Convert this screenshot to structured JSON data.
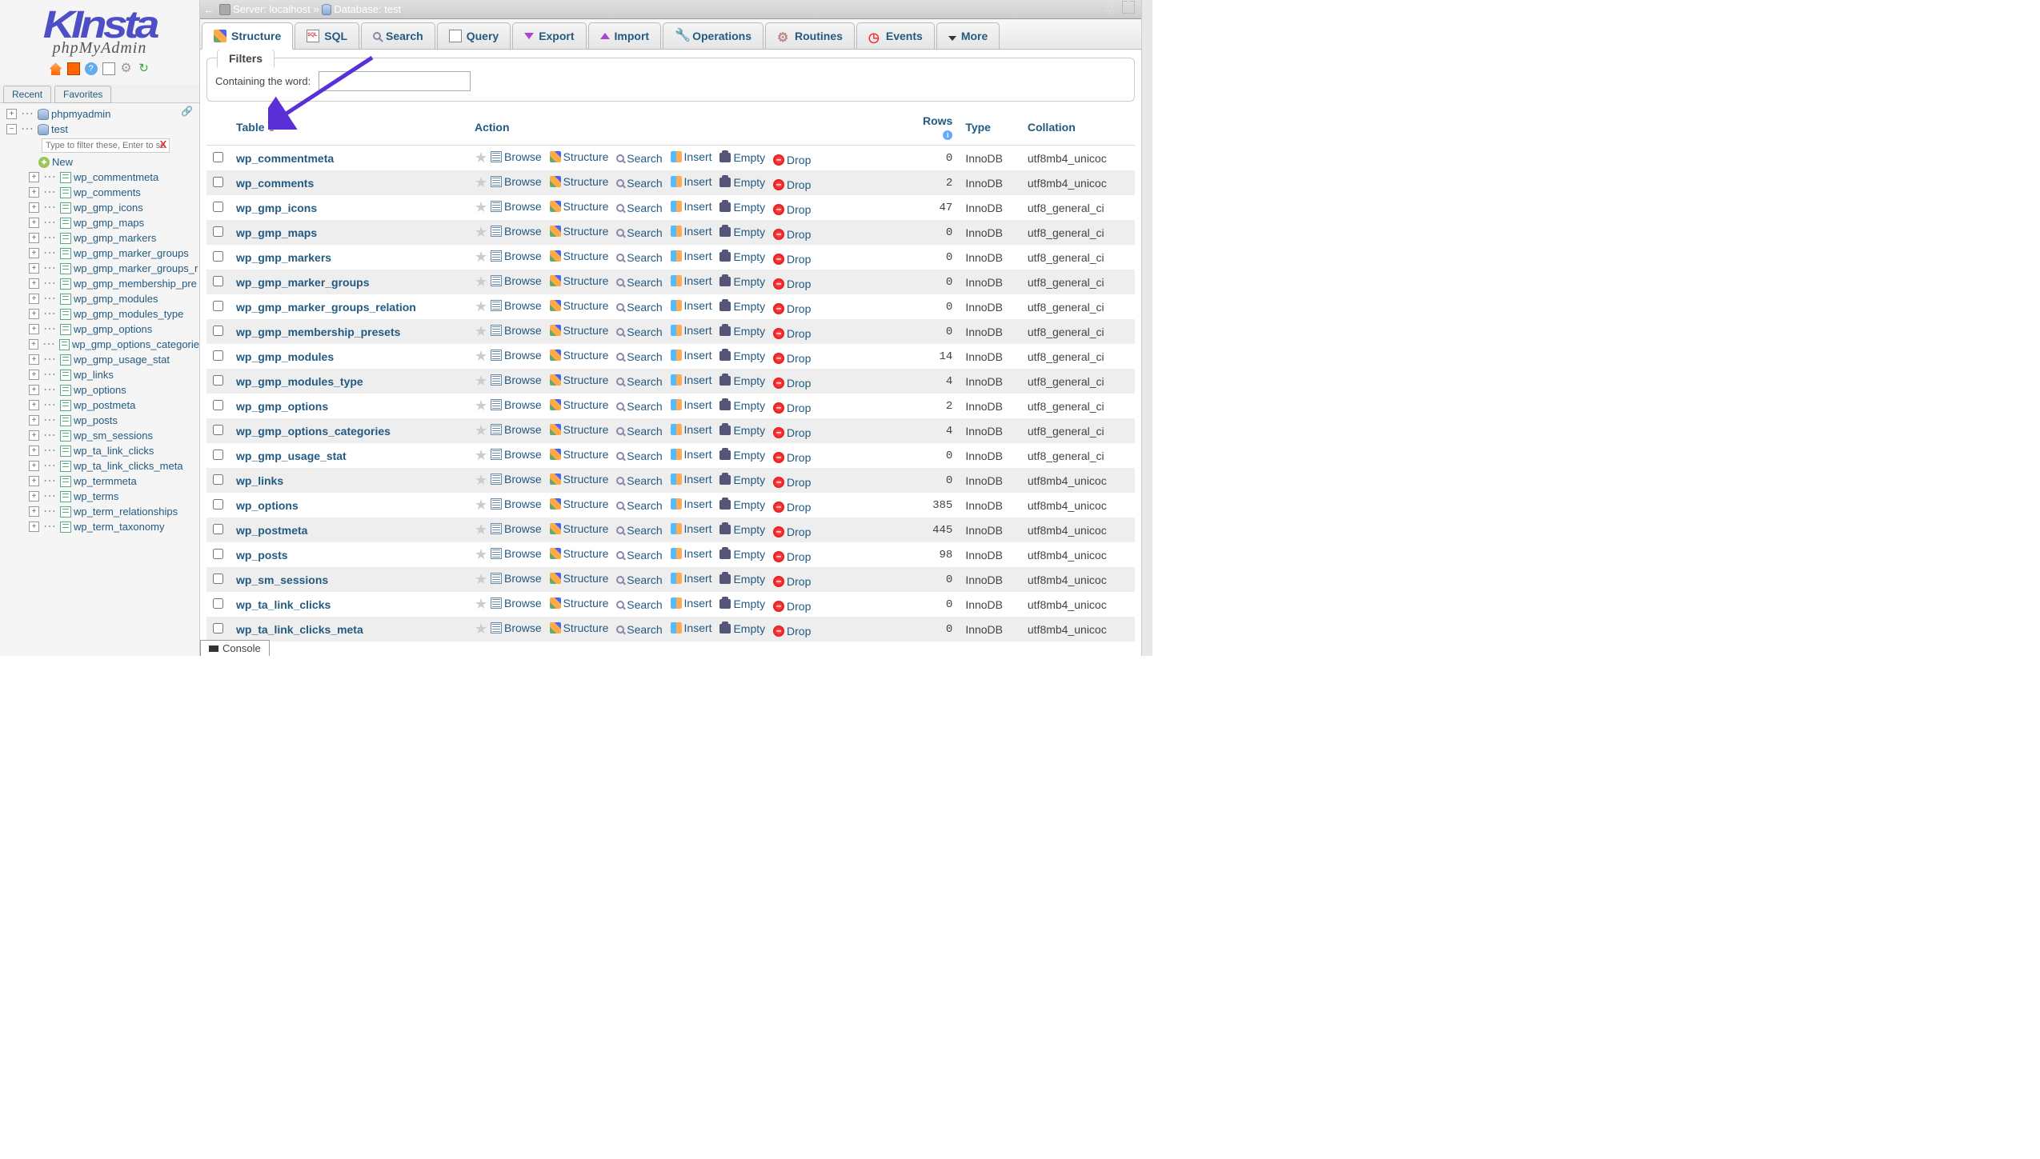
{
  "logo": {
    "main": "KInsta",
    "sub": "phpMyAdmin"
  },
  "left_tabs": {
    "recent": "Recent",
    "favorites": "Favorites"
  },
  "tree": {
    "root": "phpmyadmin",
    "db": "test",
    "filter_placeholder": "Type to filter these, Enter to search",
    "new_label": "New",
    "tables": [
      "wp_commentmeta",
      "wp_comments",
      "wp_gmp_icons",
      "wp_gmp_maps",
      "wp_gmp_markers",
      "wp_gmp_marker_groups",
      "wp_gmp_marker_groups_r",
      "wp_gmp_membership_pre",
      "wp_gmp_modules",
      "wp_gmp_modules_type",
      "wp_gmp_options",
      "wp_gmp_options_categorie",
      "wp_gmp_usage_stat",
      "wp_links",
      "wp_options",
      "wp_postmeta",
      "wp_posts",
      "wp_sm_sessions",
      "wp_ta_link_clicks",
      "wp_ta_link_clicks_meta",
      "wp_termmeta",
      "wp_terms",
      "wp_term_relationships",
      "wp_term_taxonomy"
    ]
  },
  "breadcrumb": {
    "server_label": "Server:",
    "server": "localhost",
    "sep": "»",
    "db_label": "Database:",
    "db": "test"
  },
  "tabs": [
    "Structure",
    "SQL",
    "Search",
    "Query",
    "Export",
    "Import",
    "Operations",
    "Routines",
    "Events",
    "More"
  ],
  "filter": {
    "title": "Filters",
    "label": "Containing the word:"
  },
  "columns": {
    "table": "Table",
    "action": "Action",
    "rows": "Rows",
    "type": "Type",
    "collation": "Collation"
  },
  "actions": {
    "browse": "Browse",
    "structure": "Structure",
    "search": "Search",
    "insert": "Insert",
    "empty": "Empty",
    "drop": "Drop"
  },
  "rows": [
    {
      "name": "wp_commentmeta",
      "rows": "0",
      "type": "InnoDB",
      "collation": "utf8mb4_unicoc"
    },
    {
      "name": "wp_comments",
      "rows": "2",
      "type": "InnoDB",
      "collation": "utf8mb4_unicoc"
    },
    {
      "name": "wp_gmp_icons",
      "rows": "47",
      "type": "InnoDB",
      "collation": "utf8_general_ci"
    },
    {
      "name": "wp_gmp_maps",
      "rows": "0",
      "type": "InnoDB",
      "collation": "utf8_general_ci"
    },
    {
      "name": "wp_gmp_markers",
      "rows": "0",
      "type": "InnoDB",
      "collation": "utf8_general_ci"
    },
    {
      "name": "wp_gmp_marker_groups",
      "rows": "0",
      "type": "InnoDB",
      "collation": "utf8_general_ci"
    },
    {
      "name": "wp_gmp_marker_groups_relation",
      "rows": "0",
      "type": "InnoDB",
      "collation": "utf8_general_ci"
    },
    {
      "name": "wp_gmp_membership_presets",
      "rows": "0",
      "type": "InnoDB",
      "collation": "utf8_general_ci"
    },
    {
      "name": "wp_gmp_modules",
      "rows": "14",
      "type": "InnoDB",
      "collation": "utf8_general_ci"
    },
    {
      "name": "wp_gmp_modules_type",
      "rows": "4",
      "type": "InnoDB",
      "collation": "utf8_general_ci"
    },
    {
      "name": "wp_gmp_options",
      "rows": "2",
      "type": "InnoDB",
      "collation": "utf8_general_ci"
    },
    {
      "name": "wp_gmp_options_categories",
      "rows": "4",
      "type": "InnoDB",
      "collation": "utf8_general_ci"
    },
    {
      "name": "wp_gmp_usage_stat",
      "rows": "0",
      "type": "InnoDB",
      "collation": "utf8_general_ci"
    },
    {
      "name": "wp_links",
      "rows": "0",
      "type": "InnoDB",
      "collation": "utf8mb4_unicoc"
    },
    {
      "name": "wp_options",
      "rows": "385",
      "type": "InnoDB",
      "collation": "utf8mb4_unicoc"
    },
    {
      "name": "wp_postmeta",
      "rows": "445",
      "type": "InnoDB",
      "collation": "utf8mb4_unicoc"
    },
    {
      "name": "wp_posts",
      "rows": "98",
      "type": "InnoDB",
      "collation": "utf8mb4_unicoc"
    },
    {
      "name": "wp_sm_sessions",
      "rows": "0",
      "type": "InnoDB",
      "collation": "utf8mb4_unicoc"
    },
    {
      "name": "wp_ta_link_clicks",
      "rows": "0",
      "type": "InnoDB",
      "collation": "utf8mb4_unicoc"
    },
    {
      "name": "wp_ta_link_clicks_meta",
      "rows": "0",
      "type": "InnoDB",
      "collation": "utf8mb4_unicoc"
    }
  ],
  "console": "Console"
}
